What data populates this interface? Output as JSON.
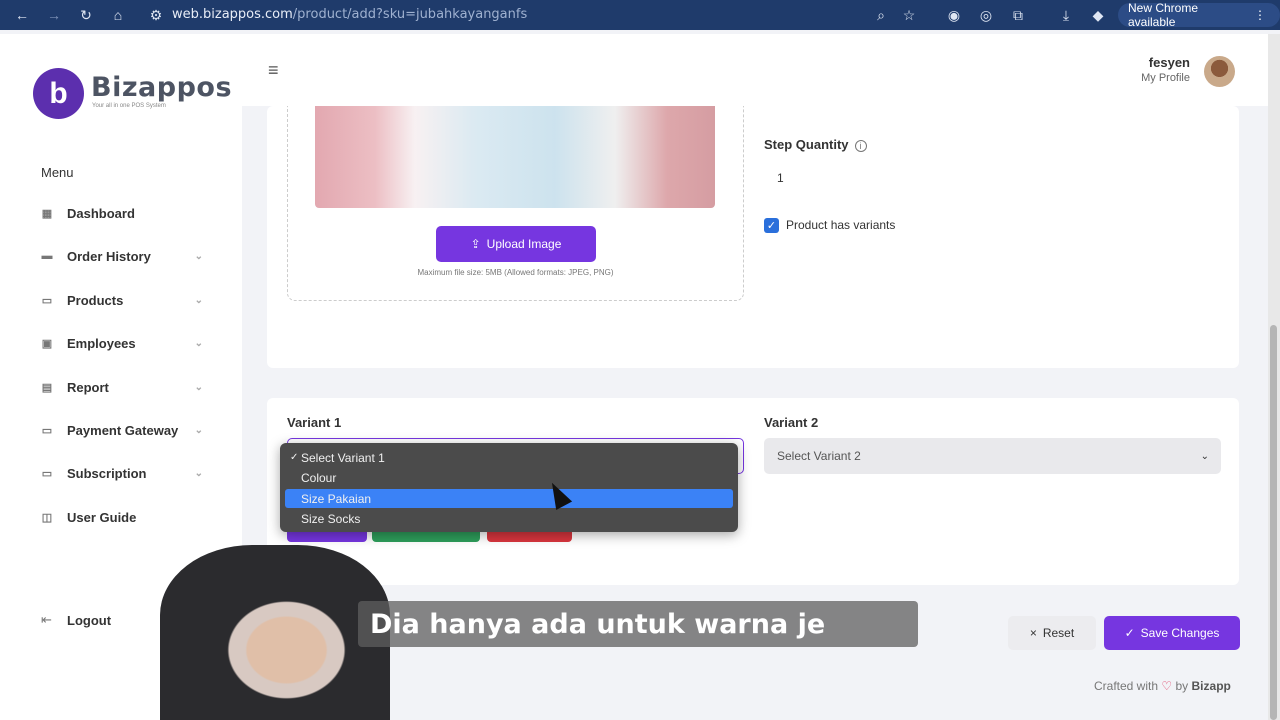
{
  "browser": {
    "url_host": "web.bizappos.com",
    "url_path": "/product/add?sku=jubahkayanganfs",
    "update_badge": "New Chrome available"
  },
  "sidebar": {
    "brand": "Bizappos",
    "tagline": "Your all in one POS System",
    "menu_heading": "Menu",
    "items": [
      {
        "label": "Dashboard",
        "icon": "grid-icon"
      },
      {
        "label": "Order History",
        "icon": "cart-icon"
      },
      {
        "label": "Products",
        "icon": "basket-icon"
      },
      {
        "label": "Employees",
        "icon": "badge-icon"
      },
      {
        "label": "Report",
        "icon": "document-icon"
      },
      {
        "label": "Payment Gateway",
        "icon": "card-icon"
      },
      {
        "label": "Subscription",
        "icon": "receipt-icon"
      },
      {
        "label": "User Guide",
        "icon": "book-icon"
      }
    ],
    "logout": "Logout"
  },
  "header": {
    "username": "fesyen",
    "profile_link": "My Profile"
  },
  "image_upload": {
    "button": "Upload Image",
    "hint": "Maximum file size: 5MB (Allowed formats: JPEG, PNG)"
  },
  "step_quantity": {
    "label": "Step Quantity",
    "value": "1"
  },
  "variants_checkbox": {
    "label": "Product has variants",
    "checked": true
  },
  "variant1": {
    "label": "Variant 1",
    "options": [
      "Select Variant 1",
      "Colour",
      "Size Pakaian",
      "Size Socks"
    ],
    "checked_option": "Select Variant 1",
    "highlighted_option": "Size Pakaian"
  },
  "variant2": {
    "label": "Variant 2",
    "placeholder": "Select Variant 2"
  },
  "actions": {
    "reset": "Reset",
    "save": "Save Changes"
  },
  "footer": {
    "crafted_prefix": "Crafted with",
    "crafted_by": "by",
    "crafted_brand": "Bizapp"
  },
  "video_overlay": {
    "subtitle": "Dia hanya ada untuk warna je"
  },
  "colors": {
    "accent": "#7636e0",
    "chrome_bar": "#1f3b6b",
    "highlight": "#3b82f6"
  }
}
